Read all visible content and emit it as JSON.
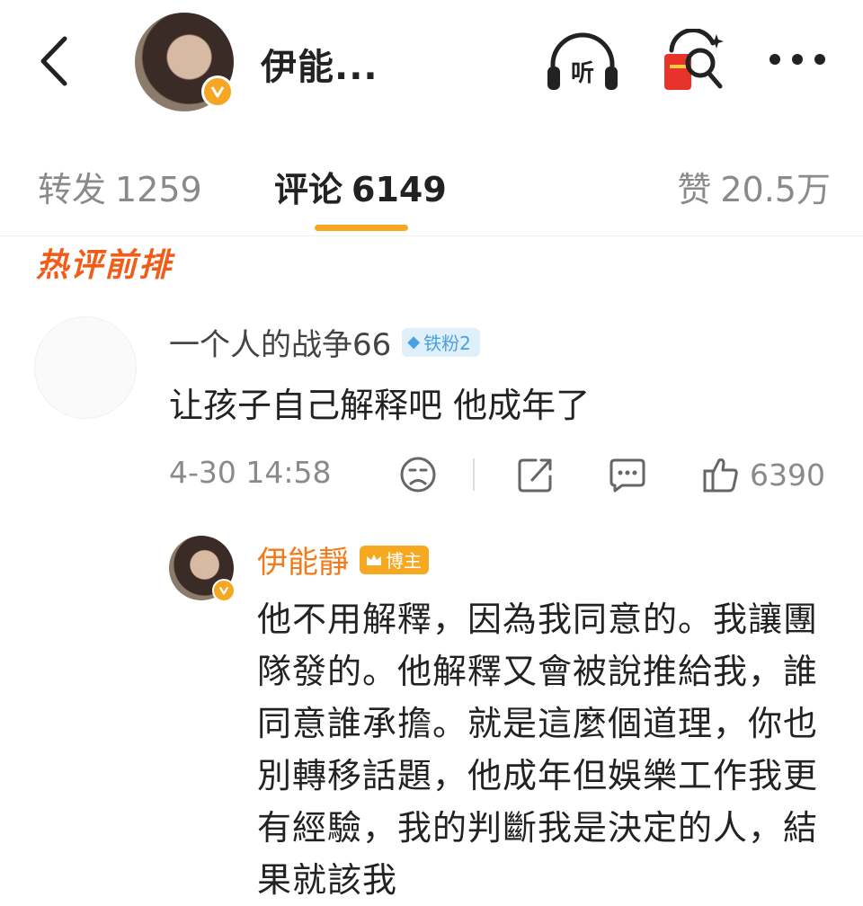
{
  "header": {
    "name": "伊能...",
    "listen_label": "听"
  },
  "tabs": [
    {
      "label": "转发",
      "count": "1259"
    },
    {
      "label": "评论",
      "count": "6149"
    },
    {
      "label": "赞",
      "count": "20.5万"
    }
  ],
  "hot_label": "热评前排",
  "comment": {
    "username": "一个人的战争66",
    "badge": "铁粉2",
    "text": "让孩子自己解释吧  他成年了",
    "time": "4-30 14:58",
    "likes": "6390"
  },
  "reply": {
    "username": "伊能靜",
    "badge": "博主",
    "text": "他不用解釋，因為我同意的。我讓團隊發的。他解釋又會被說推給我，誰同意誰承擔。就是這麼個道理，你也別轉移話題，他成年但娛樂工作我更有經驗，我的判斷我是決定的人，結果就該我"
  },
  "colors": {
    "accent": "#f7a821",
    "hot_label": "#f25c19",
    "author_name": "#f27a1a",
    "fan_badge_bg": "#dff0fb",
    "fan_badge_text": "#4aa0e0",
    "red_packet": "#e8332a"
  },
  "icons": [
    "back-arrow-icon",
    "verified-icon",
    "headphones-icon",
    "red-packet-search-icon",
    "more-icon",
    "diamond-icon",
    "dislike-face-icon",
    "share-icon",
    "comment-icon",
    "thumbs-up-icon",
    "crown-icon"
  ]
}
